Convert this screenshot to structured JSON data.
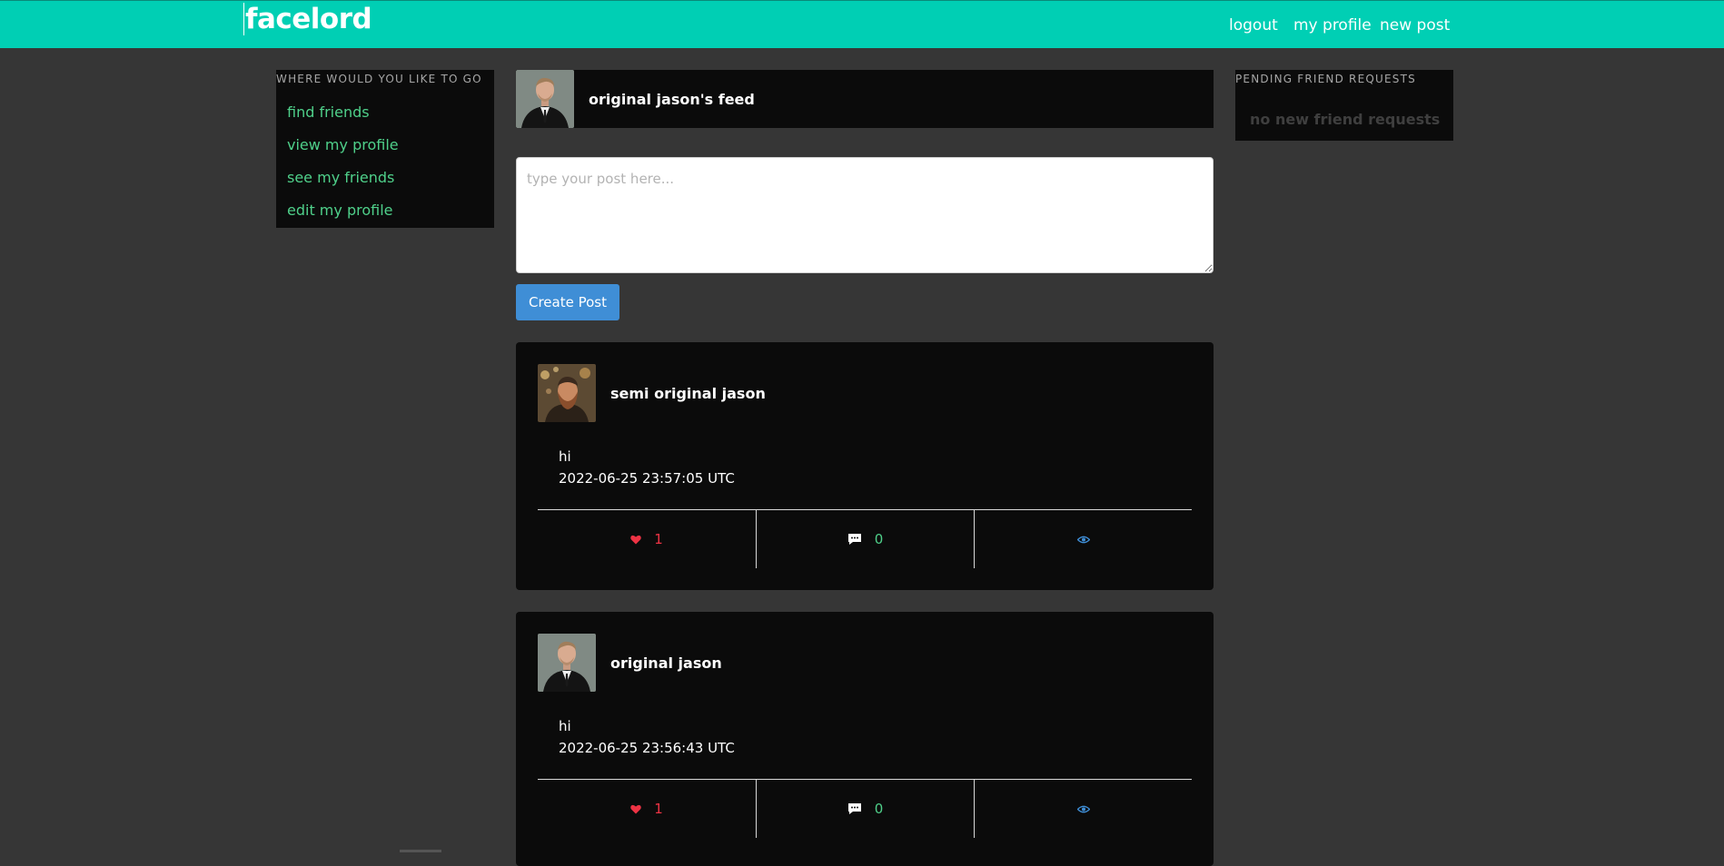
{
  "header": {
    "brand": "facelord",
    "nav": {
      "logout": "logout",
      "my_profile": "my profile",
      "new_post": "new post"
    }
  },
  "sidebar": {
    "heading": "WHERE WOULD YOU LIKE TO GO",
    "links": [
      "find friends",
      "view my profile",
      "see my friends",
      "edit my profile"
    ]
  },
  "requests": {
    "heading": "PENDING FRIEND REQUESTS",
    "empty": "no new friend requests"
  },
  "feed": {
    "title": "original jason's feed",
    "avatar_icon": "suited-man-avatar"
  },
  "composer": {
    "placeholder": "type your post here...",
    "button": "Create Post"
  },
  "posts": [
    {
      "author": "semi original jason",
      "avatar_icon": "bearded-man-avatar",
      "text": "hi",
      "timestamp": "2022-06-25 23:57:05 UTC",
      "likes": "1",
      "comments": "0"
    },
    {
      "author": "original jason",
      "avatar_icon": "suited-man-avatar",
      "text": "hi",
      "timestamp": "2022-06-25 23:56:43 UTC",
      "likes": "1",
      "comments": "0"
    }
  ],
  "colors": {
    "topbar": "#00cfb4",
    "background": "#363636",
    "panel": "#0b0b0b",
    "link": "#4fd08a",
    "button": "#3f8ed6",
    "like": "#ee3344",
    "view": "#3f8ed6"
  }
}
